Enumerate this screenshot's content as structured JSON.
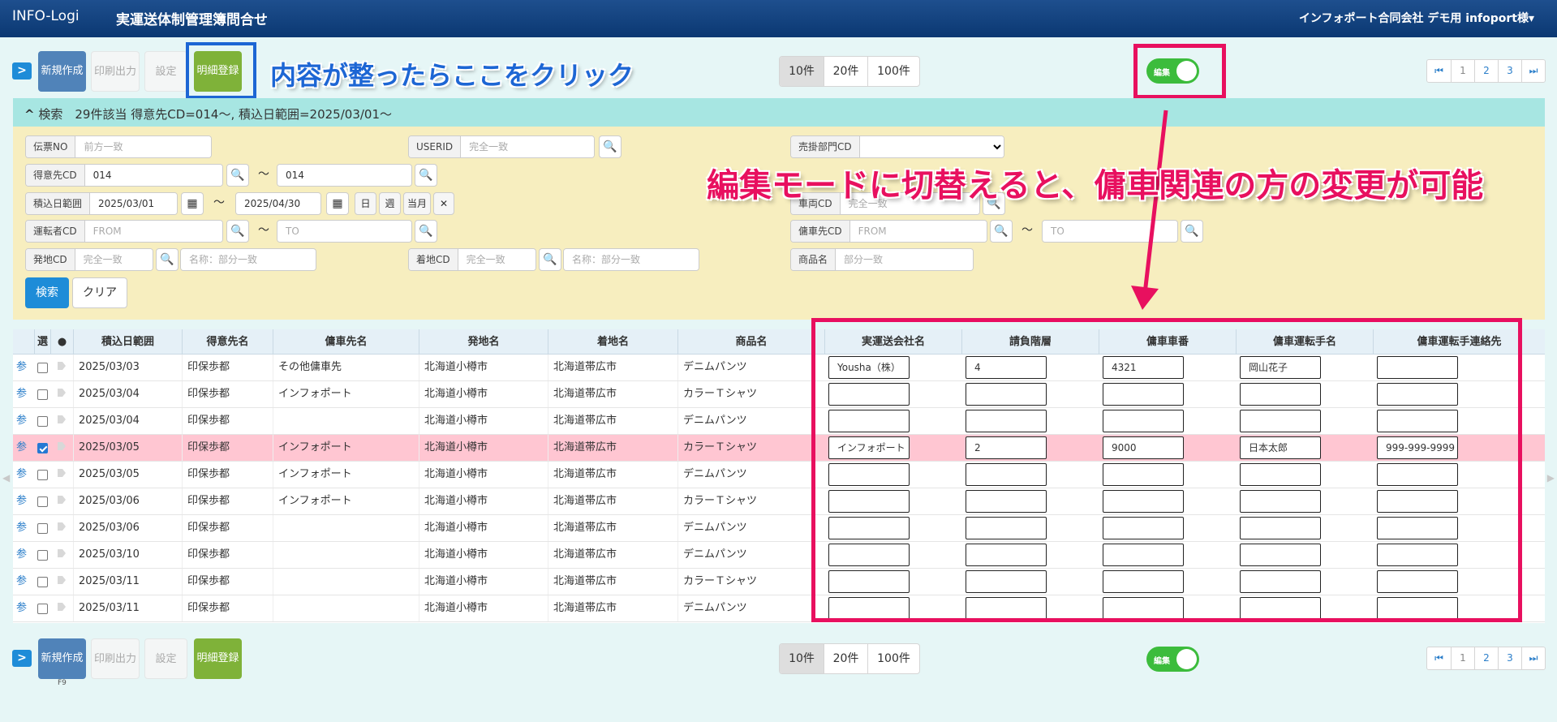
{
  "header": {
    "logo": "INFO-Logi",
    "title": "実運送体制管理簿問合せ",
    "user": "インフォポート合同会社 デモ用 infoport様▾"
  },
  "toolbar": {
    "expand": ">",
    "new_label": "新規作成",
    "print_label": "印刷出力",
    "settings_label": "設定",
    "register_label": "明細登録",
    "new_hotkey": "F9"
  },
  "page_size": [
    "10件",
    "20件",
    "100件"
  ],
  "edit_toggle": {
    "label": "編集",
    "on": true
  },
  "pager": {
    "first": "⏮",
    "pages": [
      "1",
      "2",
      "3"
    ],
    "last": "⏭"
  },
  "annotations": {
    "register_hint": "内容が整ったらここをクリック",
    "edit_hint": "編集モードに切替えると、傭車関連の方の変更が可能"
  },
  "search": {
    "summary": "検索　29件該当 得意先CD=014〜, 積込日範囲=2025/03/01〜",
    "denpyo_label": "伝票NO",
    "denpyo_ph": "前方一致",
    "userid_label": "USERID",
    "userid_ph": "完全一致",
    "bumon_label": "売掛部門CD",
    "tokui_label": "得意先CD",
    "tokui_from": "014",
    "tokui_to": "014",
    "date_label": "積込日範囲",
    "date_from": "2025/03/01",
    "date_to": "2025/04/30",
    "day_btn": "日",
    "week_btn": "週",
    "month_btn": "当月",
    "clear_x": "✕",
    "sharyo_label": "車両CD",
    "sharyo_ph": "完全一致",
    "driver_label": "運転者CD",
    "from_ph": "FROM",
    "to_ph": "TO",
    "yosha_label": "傭車先CD",
    "hatsu_label": "発地CD",
    "chaku_label": "着地CD",
    "exact_ph": "完全一致",
    "name_ph": "名称：部分一致",
    "shohin_label": "商品名",
    "shohin_ph": "部分一致",
    "search_btn": "検索",
    "clear_btn": "クリア",
    "tilde": "〜",
    "search_icon": "🔍",
    "cal_icon": "▦",
    "collapse_icon": "^"
  },
  "grid": {
    "headers": [
      "選",
      "積込日範囲",
      "得意先名",
      "傭車先名",
      "発地名",
      "着地名",
      "商品名",
      "実運送会社名",
      "請負階層",
      "傭車車番",
      "傭車運転手名",
      "傭車運転手連絡先"
    ],
    "ref_label": "参",
    "rows": [
      {
        "date": "2025/03/03",
        "tokui": "印保歩都",
        "yosha": "その他傭車先",
        "hatsu": "北海道小樽市",
        "chaku": "北海道帯広市",
        "shohin": "デニムパンツ",
        "jitsu": "Yousha（株）",
        "kaiso": "4",
        "shaban": "4321",
        "driver": "岡山花子",
        "renraku": "",
        "checked": false
      },
      {
        "date": "2025/03/04",
        "tokui": "印保歩都",
        "yosha": "インフォポート",
        "hatsu": "北海道小樽市",
        "chaku": "北海道帯広市",
        "shohin": "カラーＴシャツ",
        "jitsu": "",
        "kaiso": "",
        "shaban": "",
        "driver": "",
        "renraku": "",
        "checked": false
      },
      {
        "date": "2025/03/04",
        "tokui": "印保歩都",
        "yosha": "",
        "hatsu": "北海道小樽市",
        "chaku": "北海道帯広市",
        "shohin": "デニムパンツ",
        "jitsu": "",
        "kaiso": "",
        "shaban": "",
        "driver": "",
        "renraku": "",
        "checked": false
      },
      {
        "date": "2025/03/05",
        "tokui": "印保歩都",
        "yosha": "インフォポート",
        "hatsu": "北海道小樽市",
        "chaku": "北海道帯広市",
        "shohin": "カラーＴシャツ",
        "jitsu": "インフォポート",
        "kaiso": "2",
        "shaban": "9000",
        "driver": "日本太郎",
        "renraku": "999-999-9999",
        "checked": true
      },
      {
        "date": "2025/03/05",
        "tokui": "印保歩都",
        "yosha": "インフォポート",
        "hatsu": "北海道小樽市",
        "chaku": "北海道帯広市",
        "shohin": "デニムパンツ",
        "jitsu": "",
        "kaiso": "",
        "shaban": "",
        "driver": "",
        "renraku": "",
        "checked": false
      },
      {
        "date": "2025/03/06",
        "tokui": "印保歩都",
        "yosha": "インフォポート",
        "hatsu": "北海道小樽市",
        "chaku": "北海道帯広市",
        "shohin": "カラーＴシャツ",
        "jitsu": "",
        "kaiso": "",
        "shaban": "",
        "driver": "",
        "renraku": "",
        "checked": false
      },
      {
        "date": "2025/03/06",
        "tokui": "印保歩都",
        "yosha": "",
        "hatsu": "北海道小樽市",
        "chaku": "北海道帯広市",
        "shohin": "デニムパンツ",
        "jitsu": "",
        "kaiso": "",
        "shaban": "",
        "driver": "",
        "renraku": "",
        "checked": false
      },
      {
        "date": "2025/03/10",
        "tokui": "印保歩都",
        "yosha": "",
        "hatsu": "北海道小樽市",
        "chaku": "北海道帯広市",
        "shohin": "デニムパンツ",
        "jitsu": "",
        "kaiso": "",
        "shaban": "",
        "driver": "",
        "renraku": "",
        "checked": false
      },
      {
        "date": "2025/03/11",
        "tokui": "印保歩都",
        "yosha": "",
        "hatsu": "北海道小樽市",
        "chaku": "北海道帯広市",
        "shohin": "カラーＴシャツ",
        "jitsu": "",
        "kaiso": "",
        "shaban": "",
        "driver": "",
        "renraku": "",
        "checked": false
      },
      {
        "date": "2025/03/11",
        "tokui": "印保歩都",
        "yosha": "",
        "hatsu": "北海道小樽市",
        "chaku": "北海道帯広市",
        "shohin": "デニムパンツ",
        "jitsu": "",
        "kaiso": "",
        "shaban": "",
        "driver": "",
        "renraku": "",
        "checked": false
      }
    ]
  },
  "colors": {
    "header": "#0b3872",
    "accent": "#1e8cd8",
    "register": "#7fb239",
    "highlight_box": "#e8105f",
    "blue_box": "#1d66d4",
    "selected_row": "#ffc6d2"
  }
}
